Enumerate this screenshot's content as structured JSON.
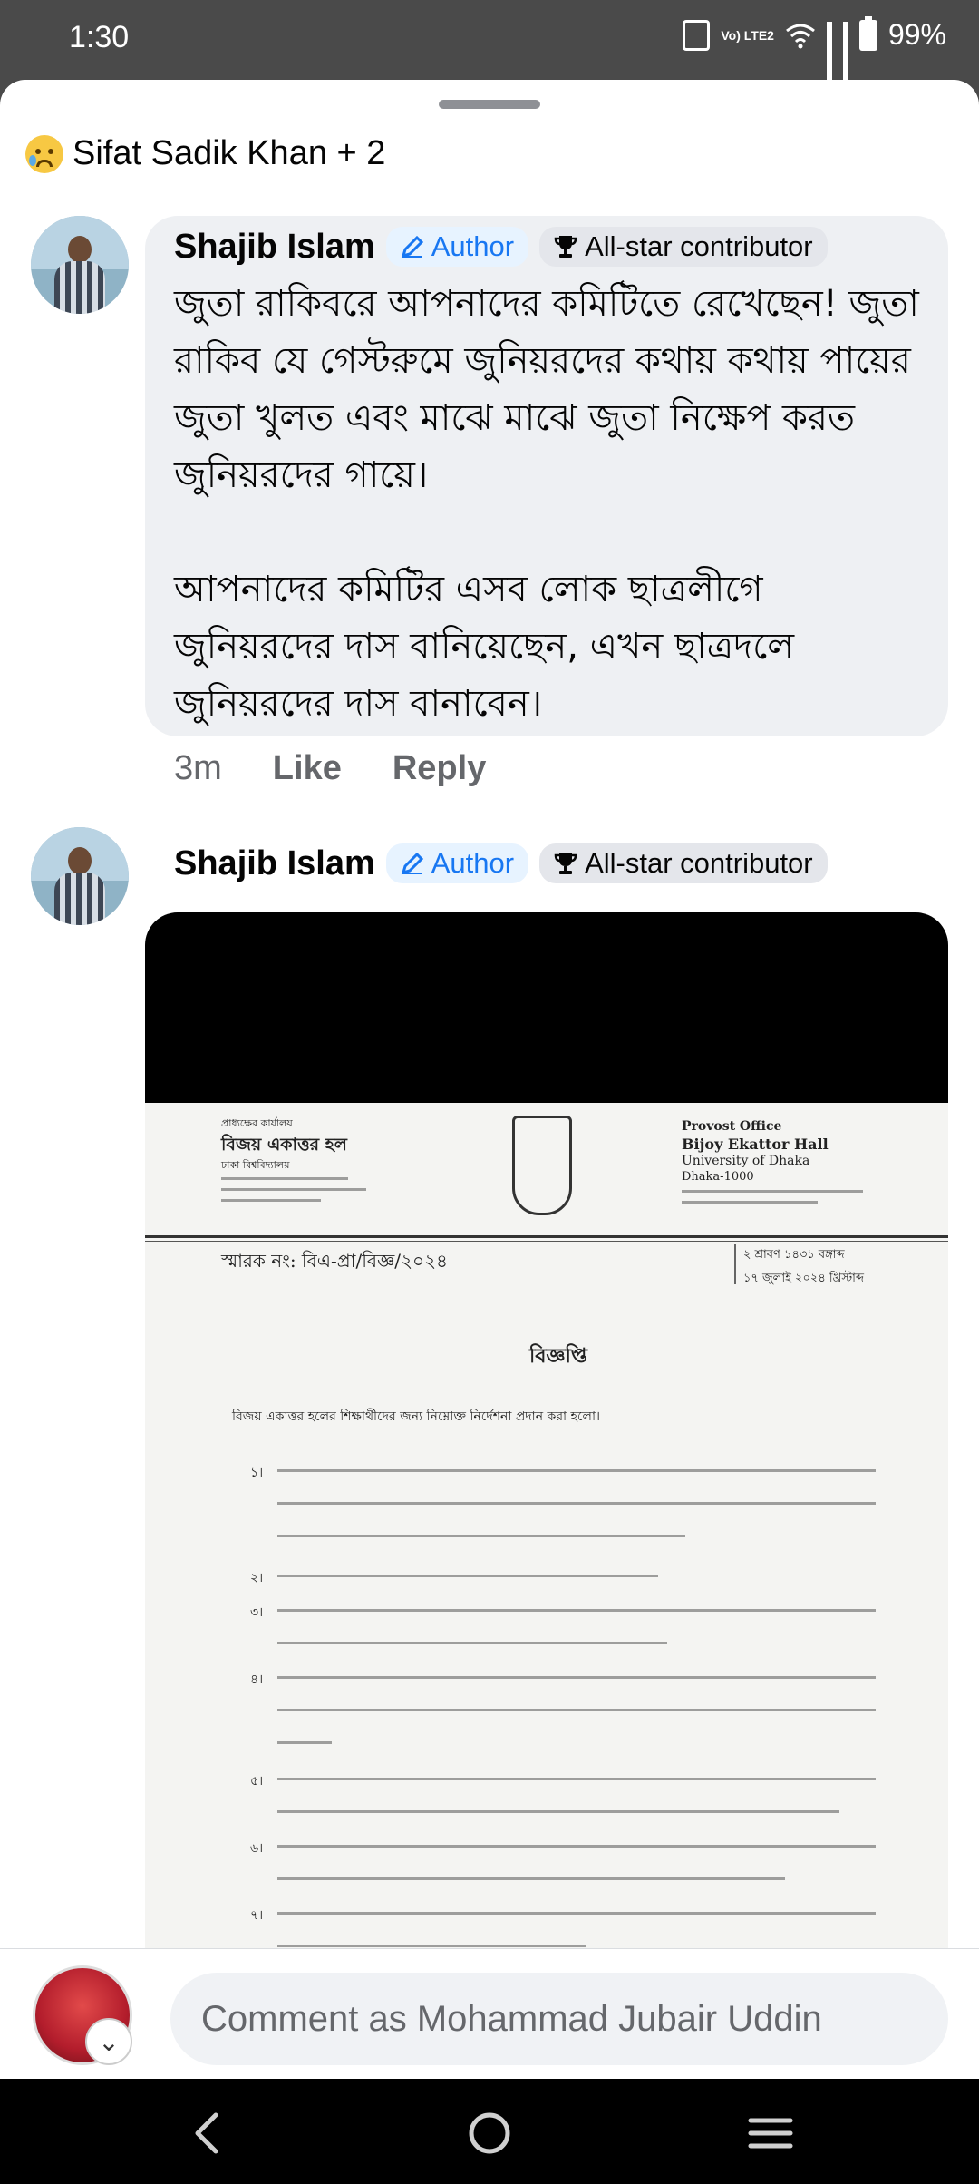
{
  "status_bar": {
    "time": "1:30",
    "volte": "Vo) LTE2",
    "battery": "99%"
  },
  "reactions": {
    "emoji": "sad-face",
    "text": "Sifat Sadik Khan + 2"
  },
  "comments": [
    {
      "author": "Shajib Islam",
      "badge_author": "Author",
      "badge_contributor": "All-star contributor",
      "text": "জুতা রাকিবরে আপনাদের কমিটিতে রেখেছেন! জুতা রাকিব যে গেস্টরুমে জুনিয়রদের কথায় কথায় পায়ের জুতা খুলত এবং মাঝে মাঝে জুতা নিক্ষেপ করত জুনিয়রদের গায়ে।\n\nআপনাদের কমিটির এসব লোক ছাত্রলীগে জুনিয়রদের দাস বানিয়েছেন, এখন ছাত্রদলে জুনিয়রদের দাস বানাবেন।",
      "time": "3m",
      "like": "Like",
      "reply": "Reply"
    },
    {
      "author": "Shajib Islam",
      "badge_author": "Author",
      "badge_contributor": "All-star contributor"
    }
  ],
  "document": {
    "office_bn": "প্রাধ্যক্ষের কার্যালয়",
    "hall_bn": "বিজয় একাত্তর হল",
    "univ_bn": "ঢাকা বিশ্ববিদ্যালয়",
    "office_en": "Provost Office",
    "hall_en": "Bijoy Ekattor Hall",
    "univ_en": "University of Dhaka",
    "city_en": "Dhaka-1000",
    "memo": "স্মারক নং: বিএ-প্রা/বিজ্ঞ/২০২৪",
    "date1": "২ শ্রাবণ ১৪৩১ বঙ্গাব্দ",
    "date2": "১৭ জুলাই ২০২৪ খ্রিস্টাব্দ",
    "title": "বিজ্ঞপ্তি",
    "intro": "বিজয় একাত্তর হলের শিক্ষার্থীদের জন্য নিম্নোক্ত নির্দেশনা প্রদান করা হলো।",
    "items": [
      "১।",
      "২।",
      "৩।",
      "৪।",
      "৫।",
      "৬।",
      "৭।"
    ]
  },
  "composer": {
    "placeholder": "Comment as Mohammad Jubair Uddin"
  },
  "colors": {
    "accent": "#1877f2",
    "bubble": "#eef0f3",
    "secondary_text": "#65676b"
  }
}
